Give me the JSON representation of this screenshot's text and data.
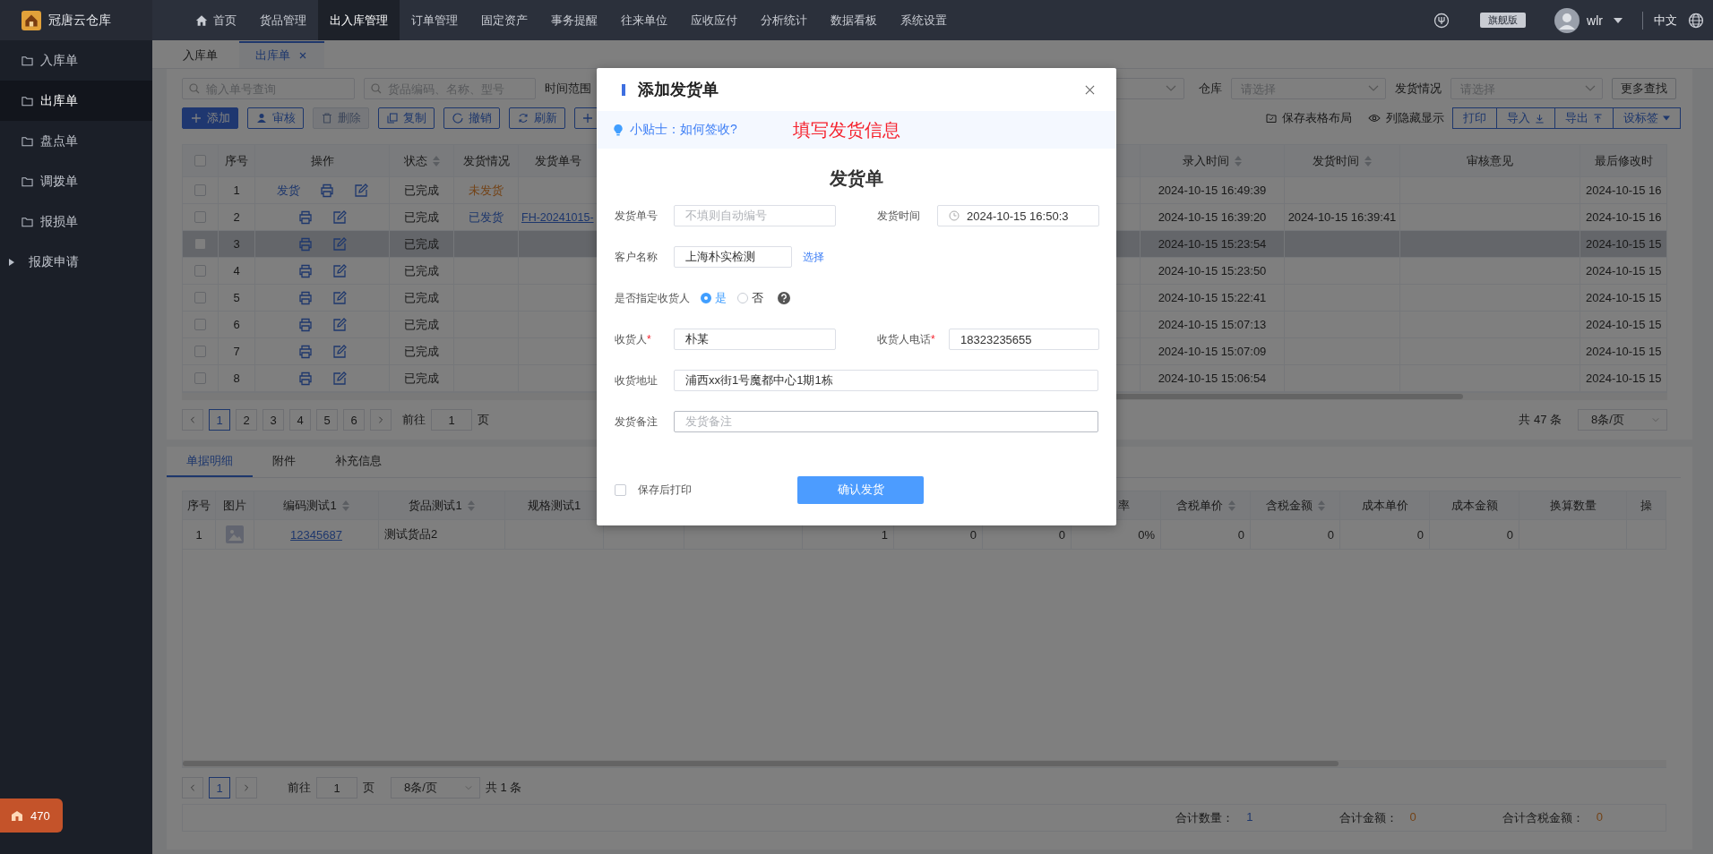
{
  "app": {
    "name": "冠唐云仓库"
  },
  "nav": [
    {
      "label": "首页",
      "selected": false,
      "kind": "home"
    },
    {
      "label": "货品管理",
      "selected": false,
      "kind": "text"
    },
    {
      "label": "出入库管理",
      "selected": true,
      "kind": "text"
    },
    {
      "label": "订单管理",
      "selected": false,
      "kind": "text"
    },
    {
      "label": "固定资产",
      "selected": false,
      "kind": "text"
    },
    {
      "label": "事务提醒",
      "selected": false,
      "kind": "text"
    },
    {
      "label": "往来单位",
      "selected": false,
      "kind": "text"
    },
    {
      "label": "应收应付",
      "selected": false,
      "kind": "text"
    },
    {
      "label": "分析统计",
      "selected": false,
      "kind": "text"
    },
    {
      "label": "数据看板",
      "selected": false,
      "kind": "text"
    },
    {
      "label": "系统设置",
      "selected": false,
      "kind": "text"
    }
  ],
  "header_right": {
    "edition": "旗舰版",
    "user": "wlr",
    "language": "中文"
  },
  "sidebar": [
    {
      "label": "入库单",
      "selected": false,
      "kind": "page"
    },
    {
      "label": "出库单",
      "selected": true,
      "kind": "page"
    },
    {
      "label": "盘点单",
      "selected": false,
      "kind": "page"
    },
    {
      "label": "调拨单",
      "selected": false,
      "kind": "page"
    },
    {
      "label": "报损单",
      "selected": false,
      "kind": "page"
    },
    {
      "label": "报废申请",
      "selected": false,
      "kind": "group"
    }
  ],
  "sidebar_badge": "470",
  "page_tabs": [
    {
      "label": "入库单",
      "selected": false,
      "closable": false
    },
    {
      "label": "出库单",
      "selected": true,
      "closable": true
    }
  ],
  "filters": {
    "order_search": {
      "placeholder": "输入单号查询"
    },
    "goods_search": {
      "placeholder": "货品编码、名称、型号"
    },
    "time_range_label": "时间范围",
    "warehouse": {
      "label": "仓库",
      "placeholder": "请选择"
    },
    "shipping_status": {
      "label": "发货情况",
      "placeholder": "请选择"
    },
    "more_button": "更多查找"
  },
  "toolbar": {
    "buttons": [
      {
        "label": "添加",
        "kind": "add",
        "primary": true,
        "disabled": false
      },
      {
        "label": "审核",
        "kind": "audit",
        "primary": false,
        "disabled": false
      },
      {
        "label": "删除",
        "kind": "delete",
        "primary": false,
        "disabled": true
      },
      {
        "label": "复制",
        "kind": "copy",
        "primary": false,
        "disabled": false
      },
      {
        "label": "撤销",
        "kind": "revoke",
        "primary": false,
        "disabled": false
      },
      {
        "label": "刷新",
        "kind": "refresh",
        "primary": false,
        "disabled": false
      },
      {
        "kind": "more",
        "primary": false,
        "disabled": false
      }
    ],
    "tools": [
      {
        "label": "保存表格布局",
        "kind": "save"
      },
      {
        "label": "列隐藏显示",
        "kind": "columns"
      }
    ],
    "button_group": [
      {
        "label": "打印",
        "kind": "plain"
      },
      {
        "label": "导入",
        "kind": "import"
      },
      {
        "label": "导出",
        "kind": "export"
      },
      {
        "label": "设标签",
        "kind": "menu"
      }
    ]
  },
  "table": {
    "select_all": {
      "checked": false
    },
    "columns_left": [
      {
        "label": "序号",
        "sortable": false
      },
      {
        "label": "操作",
        "sortable": false
      },
      {
        "label": "状态",
        "sortable": true
      },
      {
        "label": "发货情况",
        "sortable": false
      },
      {
        "label": "发货单号",
        "sortable": false
      }
    ],
    "columns_right": [
      {
        "label": "录入时间",
        "sortable": true
      },
      {
        "label": "发货时间",
        "sortable": true
      },
      {
        "label": "审核意见",
        "sortable": false
      },
      {
        "label": "最后修改时",
        "sortable": false
      }
    ],
    "rows": [
      {
        "index": "1",
        "checked": false,
        "ship_action": "发货",
        "status": "已完成",
        "shipping": {
          "text": "未发货",
          "kind": "pending"
        },
        "entry_time": "2024-10-15 16:49:39",
        "modified_time": "2024-10-15 16",
        "selected": false
      },
      {
        "index": "2",
        "checked": false,
        "status": "已完成",
        "shipping": {
          "text": "已发货",
          "kind": "shipped"
        },
        "ship_no": "FH-20241015-",
        "entry_time": "2024-10-15 16:39:20",
        "ship_time": "2024-10-15 16:39:41",
        "modified_time": "2024-10-15 16",
        "selected": false
      },
      {
        "index": "3",
        "checked": false,
        "status": "已完成",
        "entry_time": "2024-10-15 15:23:54",
        "modified_time": "2024-10-15 15",
        "selected": true
      },
      {
        "index": "4",
        "checked": false,
        "status": "已完成",
        "entry_time": "2024-10-15 15:23:50",
        "modified_time": "2024-10-15 15",
        "selected": false
      },
      {
        "index": "5",
        "checked": false,
        "status": "已完成",
        "entry_time": "2024-10-15 15:22:41",
        "modified_time": "2024-10-15 15",
        "selected": false
      },
      {
        "index": "6",
        "checked": false,
        "status": "已完成",
        "entry_time": "2024-10-15 15:07:13",
        "modified_time": "2024-10-15 15",
        "selected": false
      },
      {
        "index": "7",
        "checked": false,
        "status": "已完成",
        "entry_time": "2024-10-15 15:07:09",
        "modified_time": "2024-10-15 15",
        "selected": false
      },
      {
        "index": "8",
        "checked": false,
        "status": "已完成",
        "entry_time": "2024-10-15 15:06:54",
        "modified_time": "2024-10-15 15",
        "selected": false
      }
    ]
  },
  "pagination": {
    "pages": [
      {
        "label": "1",
        "selected": true
      },
      {
        "label": "2",
        "selected": false
      },
      {
        "label": "3",
        "selected": false
      },
      {
        "label": "4",
        "selected": false
      },
      {
        "label": "5",
        "selected": false
      },
      {
        "label": "6",
        "selected": false
      }
    ],
    "goto_label": "前往",
    "goto_value": "1",
    "goto_unit": "页",
    "total": "共 47 条",
    "page_size": "8条/页"
  },
  "detail_tabs": [
    {
      "label": "单据明细",
      "selected": true
    },
    {
      "label": "附件",
      "selected": false
    },
    {
      "label": "补充信息",
      "selected": false
    }
  ],
  "detail_table": {
    "columns_left": [
      {
        "label": "序号",
        "sortable": false
      },
      {
        "label": "图片",
        "sortable": false
      },
      {
        "label": "编码测试1",
        "sortable": true
      },
      {
        "label": "货品测试1",
        "sortable": true
      },
      {
        "label": "规格测试1",
        "sortable": false
      }
    ],
    "columns_right": [
      {
        "label": "率",
        "sortable": false
      },
      {
        "label": "含税单价",
        "sortable": true
      },
      {
        "label": "含税金额",
        "sortable": true
      },
      {
        "label": "成本单价",
        "sortable": false
      },
      {
        "label": "成本金额",
        "sortable": false
      },
      {
        "label": "换算数量",
        "sortable": false
      },
      {
        "label": "操",
        "sortable": false
      }
    ],
    "rows": [
      {
        "index": "1",
        "code": "12345687",
        "name": "测试货品2",
        "column_8": "1",
        "column_9": "0",
        "column_10": "0",
        "tax_rate": "0%",
        "tax_price": "0",
        "tax_amount": "0",
        "cost_price": "0",
        "cost_amount": "0"
      }
    ]
  },
  "detail_pagination": {
    "pages": [
      {
        "label": "1",
        "selected": true
      }
    ],
    "goto_label": "前往",
    "goto_value": "1",
    "goto_unit": "页",
    "page_size": "8条/页",
    "total": "共 1 条"
  },
  "totals": [
    {
      "label": "合计数量：",
      "value": "1",
      "kind": "count"
    },
    {
      "label": "合计金额：",
      "value": "0",
      "kind": "amount"
    },
    {
      "label": "合计含税金额：",
      "value": "0",
      "kind": "amount"
    }
  ],
  "dialog": {
    "title": "添加发货单",
    "tip_link": "小贴士：如何签收?",
    "annotation": "填写发货信息",
    "form_title": "发货单",
    "ship_no": {
      "label": "发货单号",
      "placeholder": "不填则自动编号"
    },
    "ship_time": {
      "label": "发货时间",
      "value": "2024-10-15 16:50:3"
    },
    "customer": {
      "label": "客户名称",
      "value": "上海朴实检测",
      "action": "选择"
    },
    "assign_receiver": {
      "label": "是否指定收货人",
      "options": [
        {
          "label": "是",
          "selected": true
        },
        {
          "label": "否",
          "selected": false
        }
      ]
    },
    "receiver": {
      "label": "收货人",
      "required_mark": "*",
      "value": "朴某"
    },
    "receiver_phone": {
      "label": "收货人电话",
      "required_mark": "*",
      "value": "18323235655"
    },
    "address": {
      "label": "收货地址",
      "value": "浦西xx街1号魔都中心1期1栋"
    },
    "remark": {
      "label": "发货备注",
      "placeholder": "发货备注"
    },
    "print_after_save": {
      "label": "保存后打印",
      "checked": false
    },
    "confirm_button": "确认发货"
  }
}
